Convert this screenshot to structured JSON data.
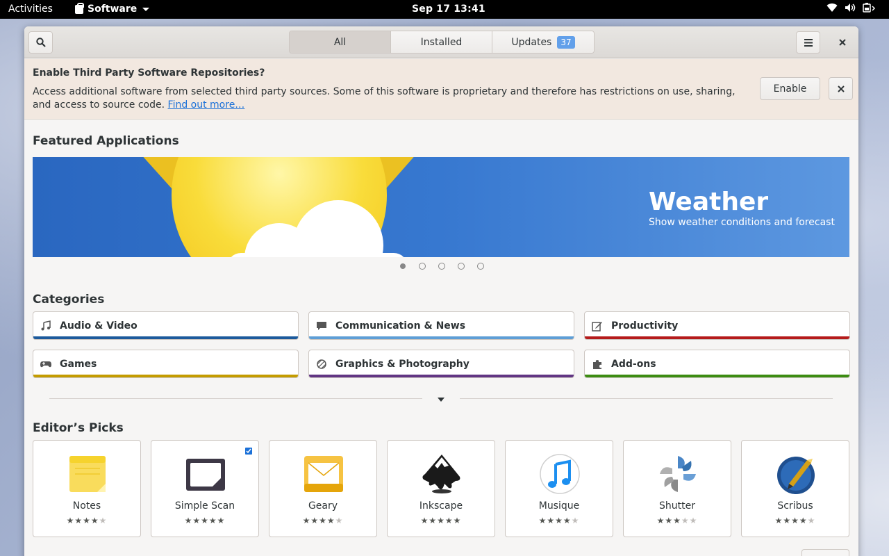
{
  "topbar": {
    "activities": "Activities",
    "app_name": "Software",
    "clock": "Sep 17  13:41"
  },
  "header": {
    "tabs": [
      {
        "label": "All"
      },
      {
        "label": "Installed"
      },
      {
        "label": "Updates",
        "badge": "37"
      }
    ]
  },
  "repo_banner": {
    "title": "Enable Third Party Software Repositories?",
    "description": "Access additional software from selected third party sources. Some of this software is proprietary and therefore has restrictions on use, sharing, and access to source code.",
    "link": "Find out more…",
    "enable_label": "Enable"
  },
  "featured": {
    "section_title": "Featured Applications",
    "app_name": "Weather",
    "app_description": "Show weather conditions and forecast",
    "page_count": 5,
    "active_page": 1
  },
  "categories": {
    "section_title": "Categories",
    "items": [
      {
        "label": "Audio & Video",
        "icon": "music-note-icon",
        "color": "#1c5a9c"
      },
      {
        "label": "Communication & News",
        "icon": "chat-bubble-icon",
        "color": "#5e9ed6"
      },
      {
        "label": "Productivity",
        "icon": "edit-icon",
        "color": "#b51b1b"
      },
      {
        "label": "Games",
        "icon": "gamepad-icon",
        "color": "#c49c00"
      },
      {
        "label": "Graphics & Photography",
        "icon": "graphics-icon",
        "color": "#613583"
      },
      {
        "label": "Add-ons",
        "icon": "puzzle-icon",
        "color": "#3c8c12"
      }
    ]
  },
  "editors_picks": {
    "section_title": "Editor’s Picks",
    "items": [
      {
        "name": "Notes",
        "rating": 4,
        "installed": false
      },
      {
        "name": "Simple Scan",
        "rating": 5,
        "installed": true
      },
      {
        "name": "Geary",
        "rating": 4,
        "installed": false
      },
      {
        "name": "Inkscape",
        "rating": 5,
        "installed": false
      },
      {
        "name": "Musique",
        "rating": 4,
        "installed": false
      },
      {
        "name": "Shutter",
        "rating": 3,
        "installed": false
      },
      {
        "name": "Scribus",
        "rating": 4,
        "installed": false
      }
    ]
  }
}
